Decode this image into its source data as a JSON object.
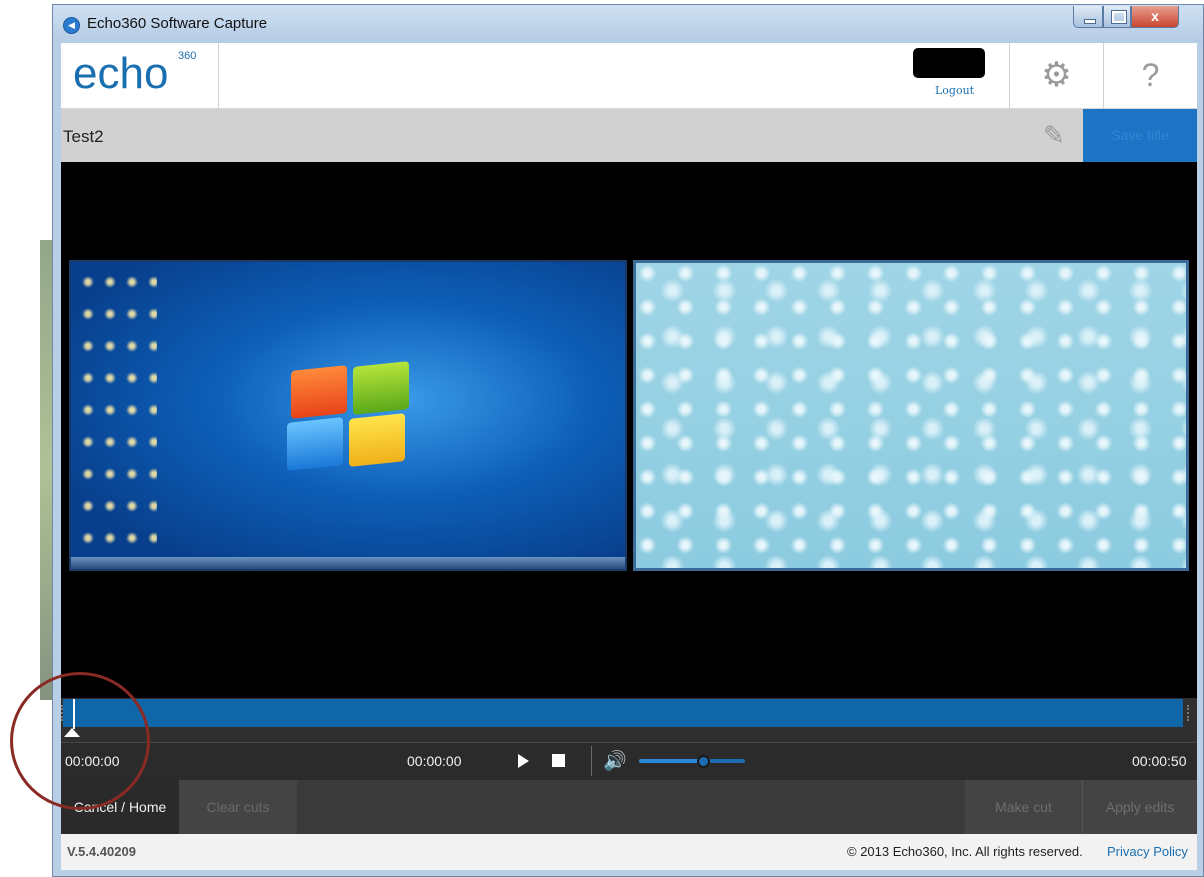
{
  "window": {
    "title": "Echo360 Software Capture",
    "close_glyph": "x"
  },
  "header": {
    "logo_text": "echo",
    "logo_superscript": "360",
    "logout_label": "Logout",
    "settings_icon": "gear-icon",
    "help_icon": "help-icon",
    "help_glyph": "?"
  },
  "capture": {
    "title_value": "Test2",
    "save_title_label": "Save title"
  },
  "playback": {
    "start_time": "00:00:00",
    "current_time": "00:00:00",
    "end_time": "00:00:50",
    "volume_level": 0.6
  },
  "actions": {
    "cancel_label": "Cancel / Home",
    "clear_cuts_label": "Clear cuts",
    "make_cut_label": "Make cut",
    "apply_edits_label": "Apply edits"
  },
  "footer": {
    "version": "V.5.4.40209",
    "copyright": "© 2013 Echo360, Inc. All rights reserved.",
    "privacy_label": "Privacy Policy"
  },
  "colors": {
    "brand_blue": "#1a6fb0",
    "save_button": "#1d74c4",
    "timeline_track": "#0f66a8",
    "annotation_circle": "#8a2a24"
  }
}
